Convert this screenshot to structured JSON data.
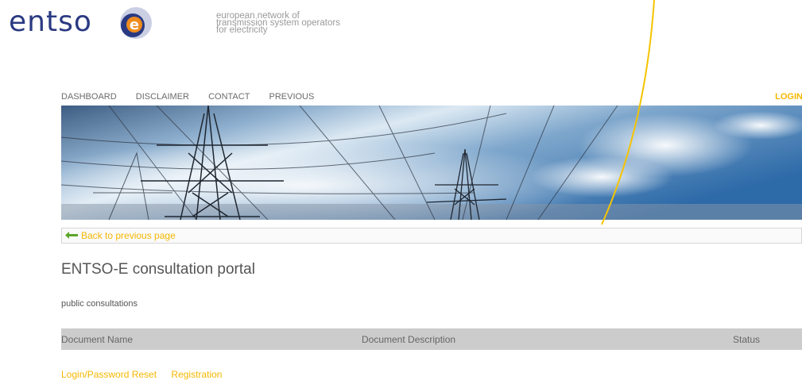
{
  "header": {
    "logo_text": "entso",
    "logo_letter": "e",
    "tagline": [
      "european network of",
      "transmission system operators",
      "for electricity"
    ]
  },
  "nav": {
    "items": [
      "DASHBOARD",
      "DISCLAIMER",
      "CONTACT",
      "PREVIOUS"
    ],
    "login_label": "LOGIN"
  },
  "back": {
    "label": "Back to previous page"
  },
  "main": {
    "title": "ENTSO-E consultation portal",
    "section_label": "public consultations"
  },
  "table": {
    "columns": [
      "Document Name",
      "Document Description",
      "Status"
    ]
  },
  "footer": {
    "links": [
      "Login/Password Reset",
      "Registration"
    ]
  },
  "colors": {
    "accent": "#f5b800",
    "brand_blue": "#2a3a82",
    "logo_orange": "#f08c1e",
    "table_header_bg": "#cccccc"
  }
}
